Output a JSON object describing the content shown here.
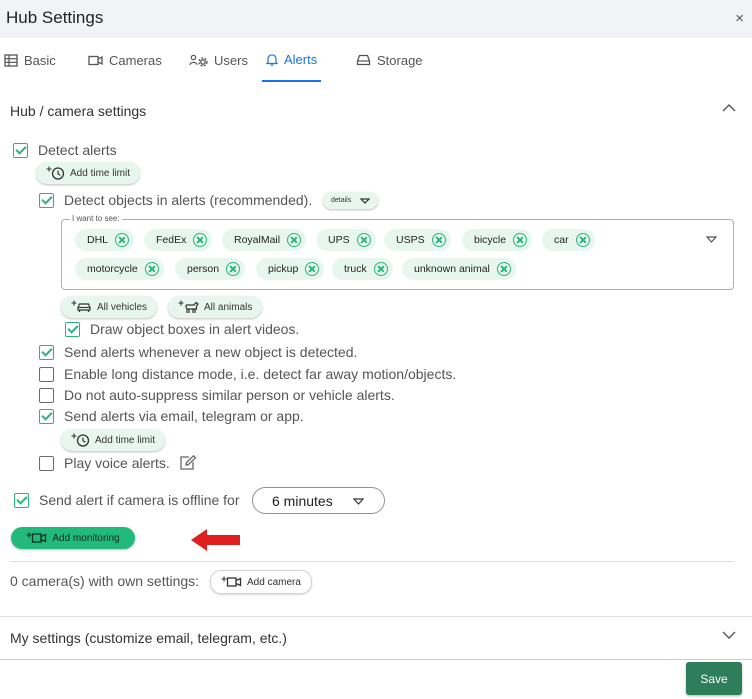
{
  "dialog": {
    "title": "Hub Settings",
    "close": "×"
  },
  "tabs": [
    {
      "label": "Basic",
      "icon": "table-icon"
    },
    {
      "label": "Cameras",
      "icon": "video-camera-icon"
    },
    {
      "label": "Users",
      "icon": "users-gear-icon"
    },
    {
      "label": "Alerts",
      "icon": "bell-icon",
      "active": true
    },
    {
      "label": "Storage",
      "icon": "hard-drive-icon"
    }
  ],
  "hub_section": {
    "label": "Hub / camera settings",
    "expanded": true
  },
  "detect_alerts": {
    "label": "Detect alerts",
    "checked": true
  },
  "add_time_limit_1": "Add time limit",
  "detect_objects": {
    "label": "Detect objects in alerts (recommended).",
    "checked": true,
    "details": "details"
  },
  "picker": {
    "legend": "I want to see:",
    "chips": [
      "DHL",
      "FedEx",
      "RoyalMail",
      "UPS",
      "USPS",
      "bicycle",
      "car",
      "motorcycle",
      "person",
      "pickup",
      "truck",
      "unknown animal"
    ]
  },
  "all_vehicles": "All vehicles",
  "all_animals": "All animals",
  "draw_boxes": {
    "label": "Draw object boxes in alert videos.",
    "checked": true
  },
  "options": [
    {
      "label": "Send alerts whenever a new object is detected.",
      "checked": true
    },
    {
      "label": "Enable long distance mode, i.e. detect far away motion/objects.",
      "checked": false
    },
    {
      "label": "Do not auto-suppress similar person or vehicle alerts.",
      "checked": false
    },
    {
      "label": "Send alerts via email, telegram or app.",
      "checked": true
    }
  ],
  "add_time_limit_2": "Add time limit",
  "voice_alerts": {
    "label": "Play voice alerts.",
    "checked": false
  },
  "offline": {
    "label": "Send alert if camera is offline for",
    "checked": true,
    "value": "6 minutes"
  },
  "add_monitoring": "Add monitoring",
  "annotation": {
    "color": "#e02020"
  },
  "own_settings": {
    "label": "0 camera(s) with own settings:",
    "button": "Add camera"
  },
  "my_settings": {
    "label": "My settings (customize email, telegram, etc.)",
    "expanded": false
  },
  "save": "Save",
  "colors": {
    "accent": "#1a73e8",
    "green": "#2bb37a",
    "save": "#2e7d5b"
  }
}
